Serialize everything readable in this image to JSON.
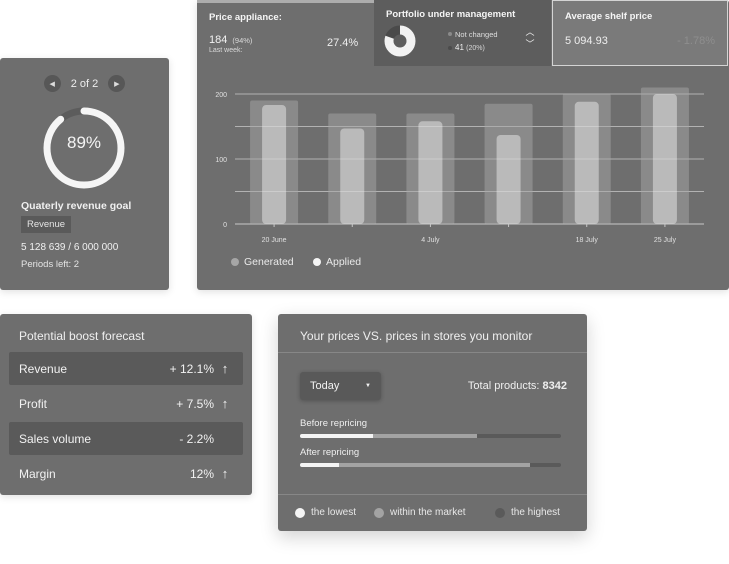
{
  "goal_card": {
    "pager": "2 of 2",
    "progress_percent": 89,
    "percent_label": "89%",
    "title": "Quaterly revenue goal",
    "badge": "Revenue",
    "amount": "5 128 639 / 6 000 000",
    "periods": "Periods left:  2"
  },
  "stats": {
    "price": {
      "title": "Price appliance:",
      "count": "184",
      "count_pct": "(94%)",
      "last_week": "Last week:",
      "pct": "27.4%"
    },
    "portfolio": {
      "title": "Portfolio under management",
      "not_changed": "Not changed",
      "count": "41",
      "count_pct": "(20%)",
      "donut_fraction": 0.8
    },
    "shelf": {
      "title": "Average shelf price",
      "value": "5 094.93",
      "pct": "- 1.78%"
    }
  },
  "chart_data": {
    "type": "bar",
    "categories": [
      "",
      "",
      "",
      "",
      "",
      "",
      ""
    ],
    "x_tick_labels": [
      "20 June",
      "",
      "4 July",
      "",
      "18 July",
      "25 July"
    ],
    "ylim": [
      0,
      200
    ],
    "y_ticks": [
      "200",
      "100",
      "0"
    ],
    "series": [
      {
        "name": "Generated",
        "values": [
          190,
          170,
          170,
          185,
          200,
          210
        ]
      },
      {
        "name": "Applied",
        "values": [
          183,
          147,
          158,
          137,
          188,
          200
        ]
      }
    ],
    "legend_position": "bottom-left",
    "grid": true
  },
  "legend": {
    "generated": "Generated",
    "applied": "Applied"
  },
  "boost": {
    "title": "Potential boost forecast",
    "rows": [
      {
        "label": "Revenue",
        "value": "+ 12.1%",
        "arrow": "↑"
      },
      {
        "label": "Profit",
        "value": "+ 7.5%",
        "arrow": "↑"
      },
      {
        "label": "Sales volume",
        "value": "- 2.2%",
        "arrow": ""
      },
      {
        "label": "Margin",
        "value": "12%",
        "arrow": "↑"
      }
    ]
  },
  "compare": {
    "title": "Your prices VS. prices in stores you monitor",
    "period": "Today",
    "total_label": "Total products:",
    "total_value": "8342",
    "before_label": "Before repricing",
    "after_label": "After repricing",
    "before": {
      "lowest": 28,
      "market": 40,
      "highest": 32
    },
    "after": {
      "lowest": 15,
      "market": 73,
      "highest": 12
    },
    "legend": {
      "lowest": "the lowest",
      "market": "within the market",
      "highest": "the highest"
    }
  },
  "colors": {
    "card": "#6e6e6e",
    "generated": "#a6a6a6",
    "applied": "#f4f4f4",
    "highest": "#5a5a5a"
  }
}
